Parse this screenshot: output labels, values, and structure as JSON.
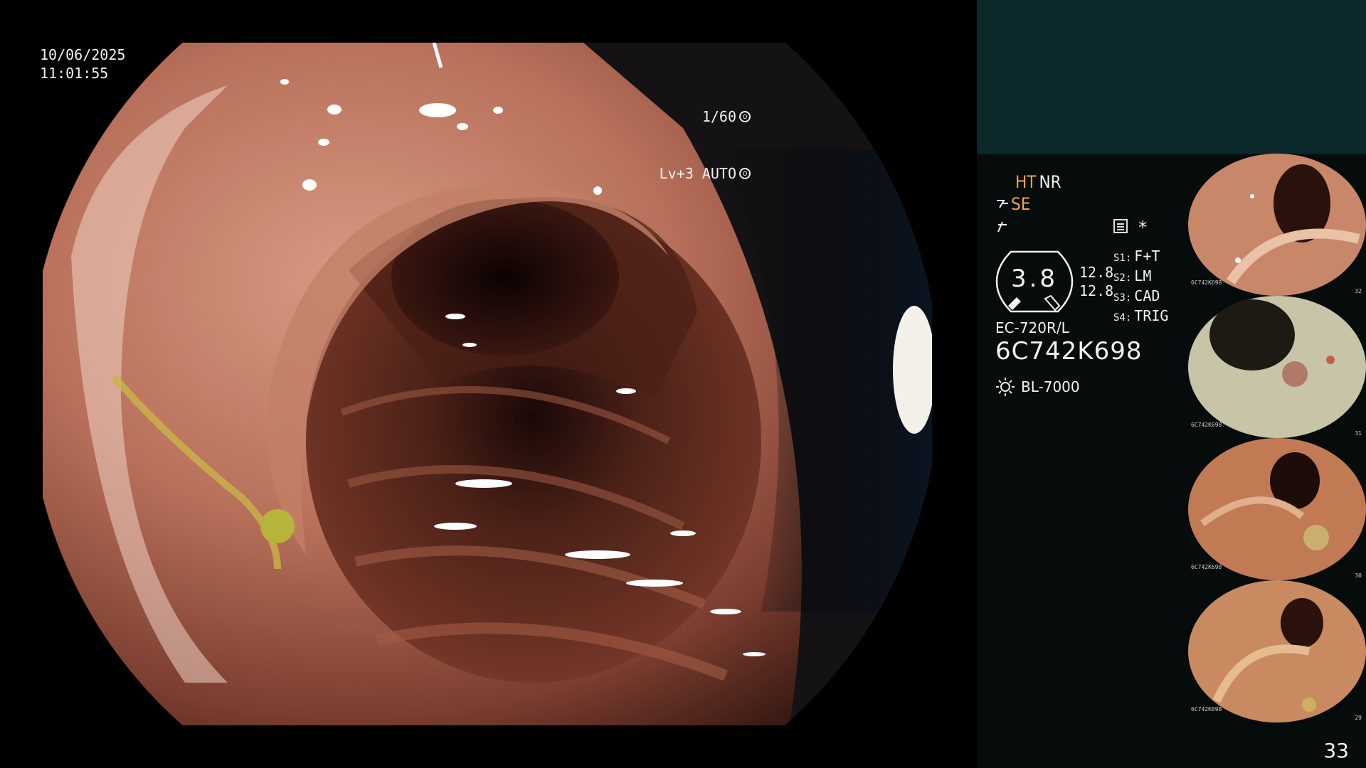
{
  "main_view": {
    "date": "10/06/2025",
    "time": "11:01:55",
    "shutter": "1/60",
    "exposure": "Lv+3 AUTO"
  },
  "panel": {
    "modes_line1": [
      "HT",
      "NR"
    ],
    "modes_line2": "SE",
    "gauge_value": "3.8",
    "side_values": [
      "12.8",
      "12.8"
    ],
    "switches": [
      {
        "key": "S1:",
        "value": "F+T"
      },
      {
        "key": "S2:",
        "value": "LM"
      },
      {
        "key": "S3:",
        "value": "CAD"
      },
      {
        "key": "S4:",
        "value": "TRIG"
      }
    ],
    "scope_model": "EC-720R/L",
    "serial": "6C742K698",
    "light_source": "BL-7000",
    "page_number": "33"
  },
  "thumbnails": [
    {
      "index": "32",
      "id": "6C742K698"
    },
    {
      "index": "31",
      "id": "6C742K698"
    },
    {
      "index": "30",
      "id": "6C742K698"
    },
    {
      "index": "29",
      "id": "6C742K698"
    }
  ],
  "colors": {
    "panel_top": "#0c2a2c",
    "panel_bg": "#060b0b",
    "accent_orange": "#f4a341",
    "mucosa": "#b56b52"
  },
  "icons": [
    "shutter-icon",
    "auto-iris-icon",
    "structure-enhance-icon",
    "color-enhance-icon",
    "menu-icon",
    "light-source-icon"
  ]
}
